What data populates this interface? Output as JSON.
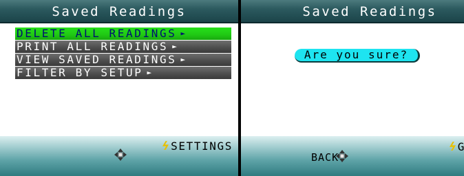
{
  "left_screen": {
    "title": "Saved Readings",
    "menu": [
      {
        "label": "DELETE ALL READINGS",
        "arrow": "►",
        "selected": true
      },
      {
        "label": "PRINT ALL READINGS",
        "arrow": "►",
        "selected": false
      },
      {
        "label": "VIEW SAVED READINGS",
        "arrow": "►",
        "selected": false
      },
      {
        "label": "FILTER BY SETUP",
        "arrow": "►",
        "selected": false
      }
    ],
    "softkeys": {
      "right_label": "SETTINGS",
      "right_icon": "lightning-bolt-icon"
    },
    "nav_icon": "dpad-icon"
  },
  "right_screen": {
    "title": "Saved Readings",
    "prompt": "Are you sure?",
    "softkeys": {
      "left_label": "BACK",
      "right_label": "GO",
      "right_icon": "lightning-bolt-icon"
    },
    "nav_icon": "dpad-icon"
  },
  "colors": {
    "title_bar": "#2c5a5f",
    "menu_selected": "#20c814",
    "menu_selected_text": "#001070",
    "menu_normal": "#4c4c4c",
    "prompt_bg": "#1ee4f0",
    "bolt": "#e8c000",
    "footer": "#5fa4a8"
  }
}
